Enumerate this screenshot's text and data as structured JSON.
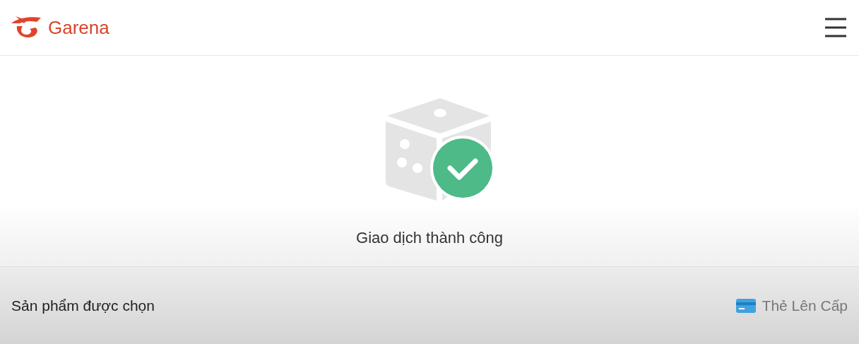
{
  "header": {
    "brand": "Garena"
  },
  "result": {
    "message": "Giao dịch thành công"
  },
  "product": {
    "label": "Sản phẩm được chọn",
    "value": "Thẻ Lên Cấp"
  }
}
